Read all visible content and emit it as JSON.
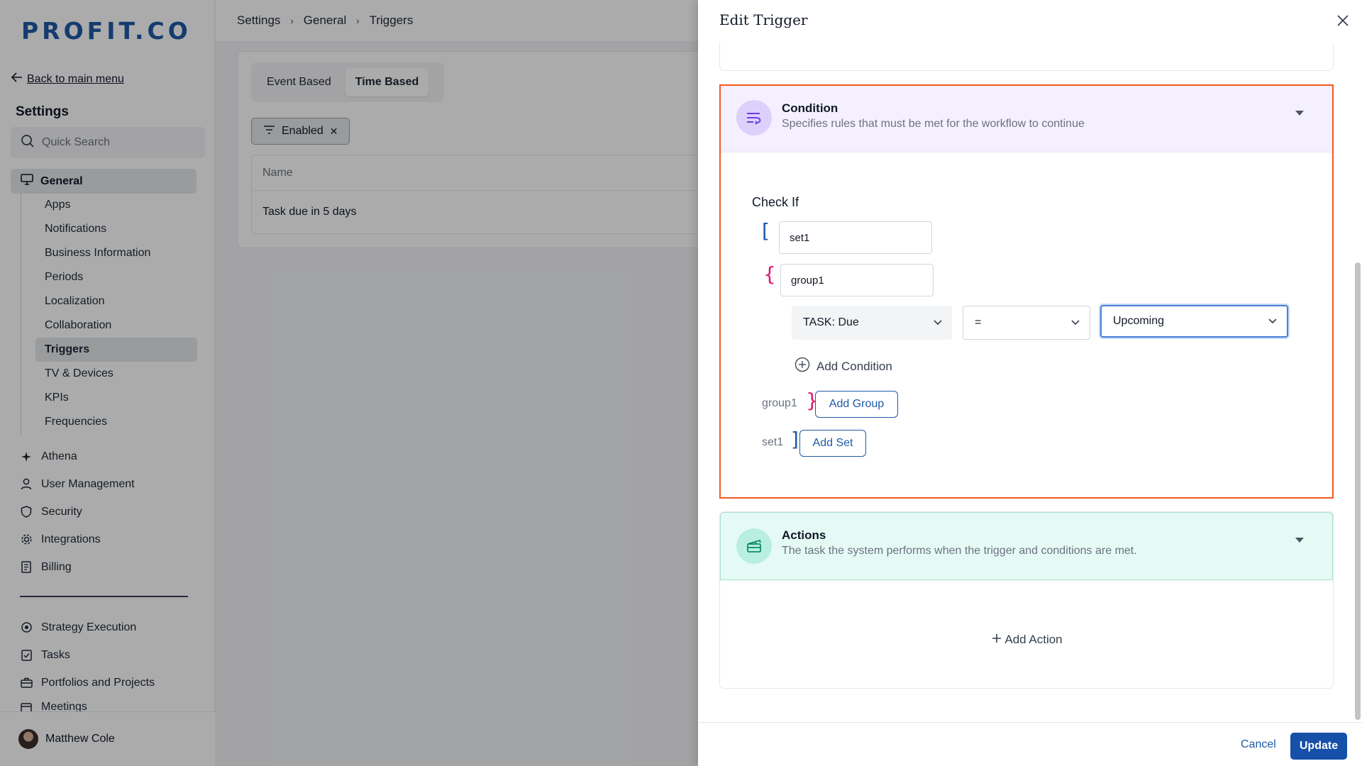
{
  "sidebar": {
    "logo": "PROFIT.CO",
    "back_link": "Back to main menu",
    "settings_title": "Settings",
    "search_placeholder": "Quick Search",
    "general_label": "General",
    "sub_items": [
      "Apps",
      "Notifications",
      "Business Information",
      "Periods",
      "Localization",
      "Collaboration",
      "Triggers",
      "TV & Devices",
      "KPIs",
      "Frequencies"
    ],
    "active_sub_item": "Triggers",
    "main_items": [
      {
        "label": "Athena",
        "icon": "sparkle-icon"
      },
      {
        "label": "User Management",
        "icon": "user-icon"
      },
      {
        "label": "Security",
        "icon": "shield-icon"
      },
      {
        "label": "Integrations",
        "icon": "gear-icon"
      },
      {
        "label": "Billing",
        "icon": "receipt-icon"
      }
    ],
    "lower_items": [
      {
        "label": "Strategy Execution",
        "icon": "target-icon"
      },
      {
        "label": "Tasks",
        "icon": "clipboard-check-icon"
      },
      {
        "label": "Portfolios and Projects",
        "icon": "briefcase-icon"
      },
      {
        "label": "Meetings",
        "icon": "calendar-icon"
      }
    ],
    "user_name": "Matthew Cole"
  },
  "breadcrumb": [
    "Settings",
    "General",
    "Triggers"
  ],
  "main": {
    "tabs": [
      "Event Based",
      "Time Based"
    ],
    "active_tab": "Time Based",
    "filter_chip": "Enabled",
    "table": {
      "header": "Name",
      "rows": [
        "Task due in 5 days"
      ]
    }
  },
  "drawer": {
    "title": "Edit Trigger",
    "condition": {
      "title": "Condition",
      "description": "Specifies rules that must be met for the workflow to continue",
      "check_if": "Check If",
      "set_name": "set1",
      "group_name": "group1",
      "field_select": "TASK: Due",
      "operator_select": "=",
      "value_select": "Upcoming",
      "add_condition": "Add Condition",
      "group_end_label": "group1",
      "add_group": "Add Group",
      "set_end_label": "set1",
      "add_set": "Add Set"
    },
    "actions": {
      "title": "Actions",
      "description": "The task the system performs when the trigger and conditions are met.",
      "add_action": "Add Action"
    },
    "footer": {
      "cancel": "Cancel",
      "update": "Update"
    }
  },
  "colors": {
    "brand_blue": "#1e5aa8",
    "highlight_orange": "#f15a22",
    "bracket_pink": "#e0196e",
    "condition_bg": "#f5f0ff",
    "actions_bg": "#e6faf5"
  }
}
